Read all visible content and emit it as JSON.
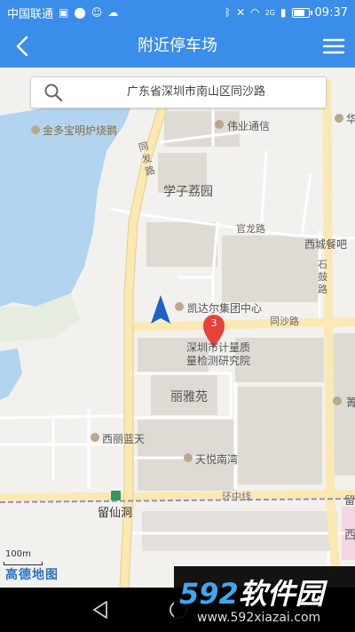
{
  "status_bar": {
    "carrier": "中国联通",
    "signal": "2G",
    "time": "09:37",
    "battery_level": 0.9
  },
  "app_bar": {
    "title": "附近停车场"
  },
  "search": {
    "address": "广东省深圳市南山区同沙路"
  },
  "map": {
    "labels": {
      "jinduo": "金多宝明炉烧鹅",
      "weiye": "伟业通信",
      "hua": "华",
      "tongfa": "同发路",
      "xuezi": "学子荔园",
      "guanlong": "官龙路",
      "xicheng": "西城餐吧",
      "shigu": "石鼓路",
      "kaidaer": "凯达尔集团中心",
      "tongsha": "同沙路",
      "jiliang1": "深圳市计量质",
      "jiliang2": "量检测研究院",
      "liya": "丽雅苑",
      "qing": "菁",
      "xili": "西丽蓝天",
      "tianyue": "天悦南湾",
      "huanzhong": "环中线",
      "liuxiandong": "留仙洞",
      "xi_right": "西",
      "liu_right": "留"
    },
    "marker_count": "3",
    "scale_label": "100m",
    "logo": "高德地图",
    "colors": {
      "water": "#b3d4f0",
      "road_major": "#fbe9b4",
      "road_minor": "#ffffff",
      "building": "#dedbd5",
      "marker": "#e8413a",
      "location": "#1f5fc6"
    }
  },
  "watermark": {
    "brand_num": "592",
    "brand_text": "软件园",
    "url": "www.592xiazai.com"
  }
}
